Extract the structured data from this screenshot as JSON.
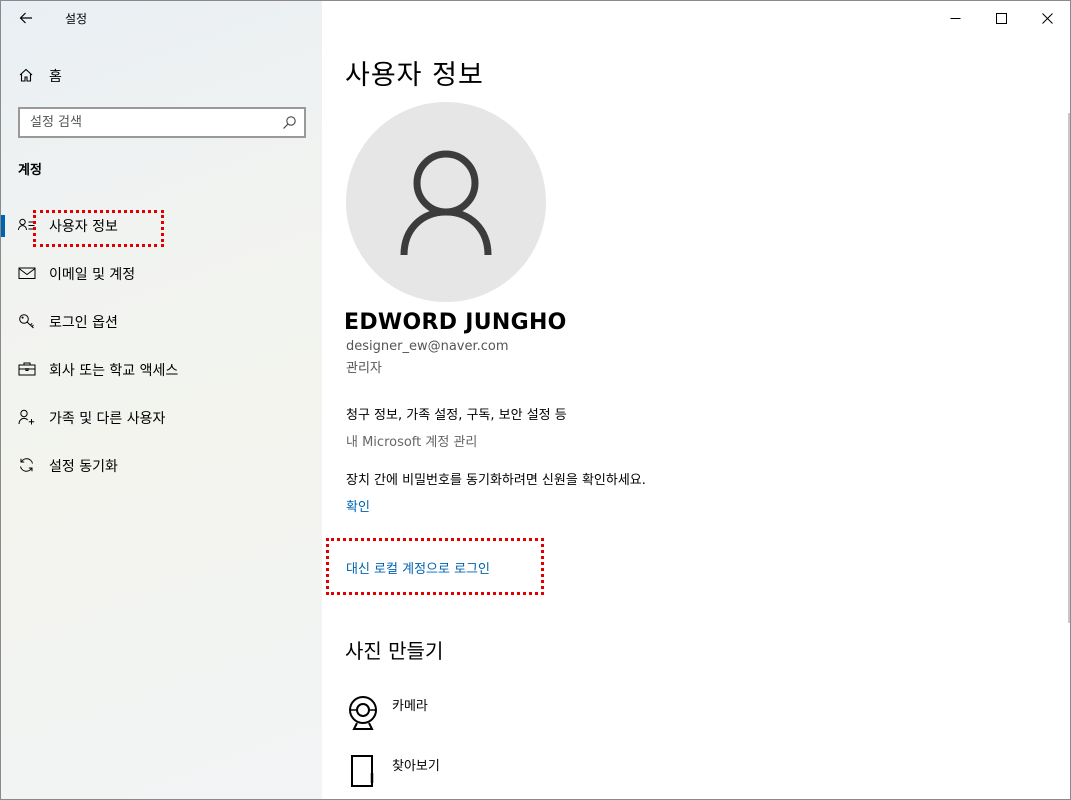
{
  "app": {
    "title": "설정"
  },
  "sidebar": {
    "home_label": "홈",
    "search_placeholder": "설정 검색",
    "section_heading": "계정",
    "items": [
      {
        "label": "사용자 정보",
        "icon": "user-info-icon",
        "selected": true
      },
      {
        "label": "이메일 및 계정",
        "icon": "mail-icon",
        "selected": false
      },
      {
        "label": "로그인 옵션",
        "icon": "key-icon",
        "selected": false
      },
      {
        "label": "회사 또는 학교 액세스",
        "icon": "briefcase-icon",
        "selected": false
      },
      {
        "label": "가족 및 다른 사용자",
        "icon": "person-add-icon",
        "selected": false
      },
      {
        "label": "설정 동기화",
        "icon": "sync-icon",
        "selected": false
      }
    ]
  },
  "main": {
    "page_title": "사용자 정보",
    "user": {
      "name": "EDWORD JUNGHO",
      "email": "designer_ew@naver.com",
      "role": "관리자"
    },
    "billing_desc": "청구 정보, 가족 설정, 구독, 보안 설정 등",
    "manage_link": "내 Microsoft 계정 관리",
    "sync_desc": "장치 간에 비밀번호를 동기화하려면 신원을 확인하세요.",
    "confirm_link": "확인",
    "local_signin_link": "대신 로컬 계정으로 로그인",
    "photo_section_title": "사진 만들기",
    "photo_options": [
      {
        "label": "카메라",
        "icon": "camera-icon"
      },
      {
        "label": "찾아보기",
        "icon": "browse-icon"
      }
    ]
  },
  "colors": {
    "accent": "#0063b1",
    "highlight_border": "#e00000",
    "avatar_bg": "#e6e6e6"
  }
}
